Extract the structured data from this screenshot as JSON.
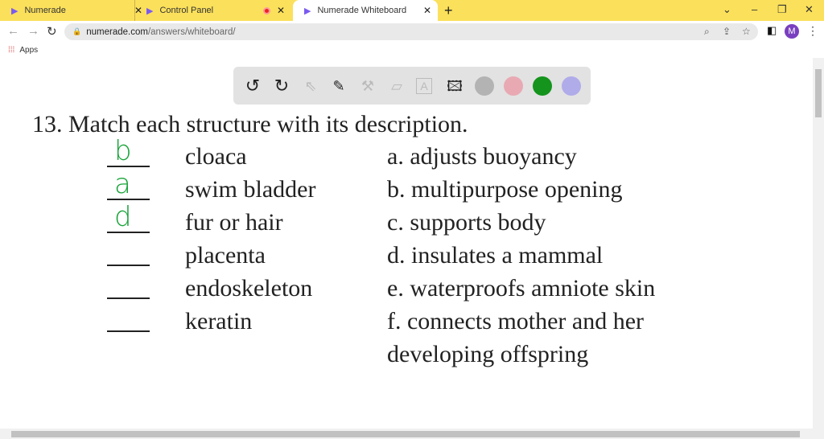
{
  "browser": {
    "tabs": [
      {
        "title": "Numerade",
        "close": "✕"
      },
      {
        "title": "Control Panel",
        "close": "✕"
      },
      {
        "title": "Numerade Whiteboard",
        "close": "✕",
        "active": true
      }
    ],
    "new_tab": "+",
    "url_host": "numerade.com",
    "url_path": "/answers/whiteboard/",
    "avatar": "M",
    "bookmarks": [
      "Apps"
    ]
  },
  "whiteboard": {
    "colors": [
      "#b3b3b3",
      "#e8a9b3",
      "#14941c",
      "#b0acea"
    ],
    "question": "13.  Match each structure with its description.",
    "rows": [
      {
        "answer": "b",
        "term": "cloaca",
        "desc": "a.  adjusts buoyancy"
      },
      {
        "answer": "a",
        "term": "swim bladder",
        "desc": "b.  multipurpose opening"
      },
      {
        "answer": "d",
        "term": "fur or hair",
        "desc": "c.  supports body"
      },
      {
        "answer": "",
        "term": "placenta",
        "desc": "d.  insulates a mammal"
      },
      {
        "answer": "",
        "term": "endoskeleton",
        "desc": "e.  waterproofs amniote skin"
      },
      {
        "answer": "",
        "term": "keratin",
        "desc": "f.  connects mother and her"
      }
    ],
    "desc_continued": "developing offspring"
  }
}
